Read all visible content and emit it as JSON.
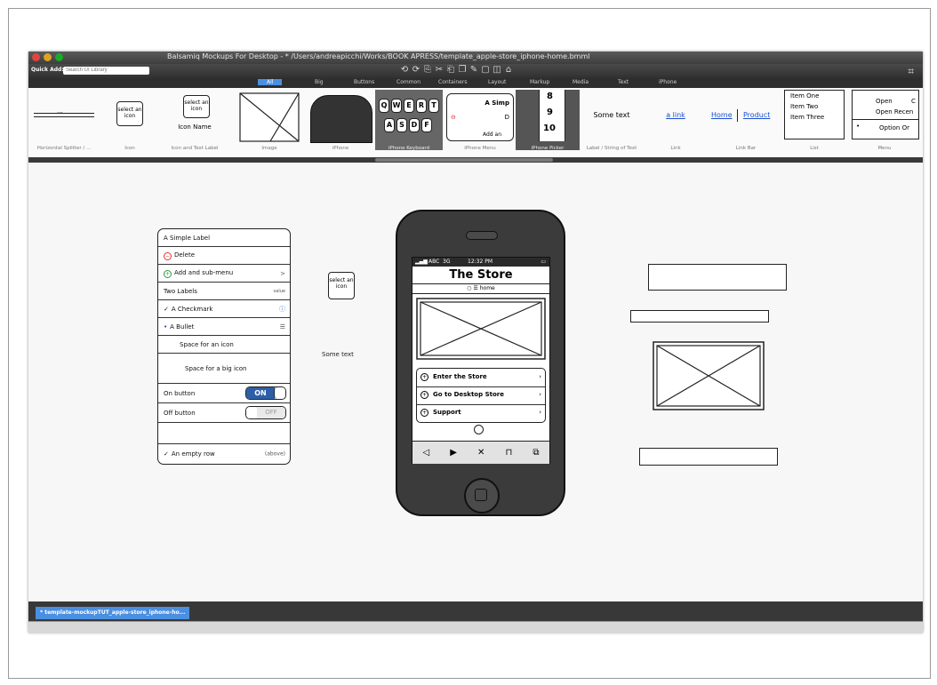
{
  "window": {
    "title": "Balsamiq Mockups For Desktop - * /Users/andreapicchi/Works/BOOK APRESS/template_apple-store_iphone-home.bmml",
    "traffic_lights": [
      "#e0443e",
      "#dea123",
      "#1aab29"
    ]
  },
  "toolbar": {
    "quick_add_label": "Quick Add:",
    "search_placeholder": "Search UI Library",
    "icons": [
      "undo-icon",
      "redo-icon",
      "copy-icon",
      "cut-icon",
      "paste-icon",
      "duplicate-icon",
      "edit-icon",
      "group-icon",
      "ungroup-icon",
      "lock-icon"
    ],
    "fullscreen_icon": "fullscreen-icon"
  },
  "categories": {
    "tabs": [
      "All",
      "Big",
      "Buttons",
      "Common",
      "Containers",
      "Layout",
      "Markup",
      "Media",
      "Text",
      "iPhone"
    ],
    "active": "All"
  },
  "library": {
    "items": [
      {
        "caption": "Horizontal Splitter / ..."
      },
      {
        "caption": "Icon",
        "text": "select an icon"
      },
      {
        "caption": "Icon and Text Label",
        "text": "select an icon",
        "label": "Icon Name"
      },
      {
        "caption": "Image"
      },
      {
        "caption": "iPhone"
      },
      {
        "caption": "iPhone Keyboard",
        "keys_top": [
          "Q",
          "W",
          "E",
          "R",
          "T"
        ],
        "keys_bottom": [
          "A",
          "S",
          "D",
          "F"
        ]
      },
      {
        "caption": "iPhone Menu",
        "text": "A Simp",
        "row2": "D",
        "row3": "Add an"
      },
      {
        "caption": "iPhone Picker",
        "values": [
          "8",
          "9",
          "10"
        ]
      },
      {
        "caption": "Label / String of Text",
        "text": "Some text"
      },
      {
        "caption": "Link",
        "text": "a link"
      },
      {
        "caption": "Link Bar",
        "links": [
          "Home",
          "Product"
        ]
      },
      {
        "caption": "List",
        "items": [
          "Item One",
          "Item Two",
          "Item Three"
        ]
      },
      {
        "caption": "Menu",
        "items": [
          "Open",
          "C",
          "Open Recen",
          "Option Or"
        ]
      }
    ]
  },
  "canvas": {
    "menu": {
      "rows": [
        {
          "label": "A Simple Label",
          "right": ""
        },
        {
          "label": "Delete",
          "right": "",
          "icon": "minus-circle-icon"
        },
        {
          "label": "Add and sub-menu",
          "right": ">",
          "icon": "plus-circle-icon"
        },
        {
          "label": "Two Labels",
          "right": "value"
        },
        {
          "label": "A Checkmark",
          "right": "",
          "icon": "checkmark-icon"
        },
        {
          "label": "A Bullet",
          "right": "",
          "icon": "bullet-icon"
        },
        {
          "label": "Space for an icon",
          "right": ""
        },
        {
          "label": "Space for a big icon",
          "right": ""
        },
        {
          "label": "On button",
          "switch": "ON"
        },
        {
          "label": "Off button",
          "switch": "OFF"
        },
        {
          "label": "",
          "right": ""
        },
        {
          "label": "An empty row",
          "right": "(above)",
          "icon": "checkmark-icon"
        }
      ]
    },
    "icon_widget": {
      "text": "select an icon"
    },
    "label_widget": {
      "text": "Some text"
    },
    "phone": {
      "carrier": "ABC",
      "network": "3G",
      "time": "12:32 PM",
      "title": "The Store",
      "nav": "home",
      "menu": [
        {
          "label": "Enter the Store"
        },
        {
          "label": "Go to Desktop Store"
        },
        {
          "label": "Support"
        }
      ],
      "toolbar_icons": [
        "back-icon",
        "play-icon",
        "close-x-icon",
        "book-icon",
        "tabs-icon"
      ]
    }
  },
  "status": {
    "document_tab": "* template-mockupTUT_apple-store_iphone-ho..."
  }
}
